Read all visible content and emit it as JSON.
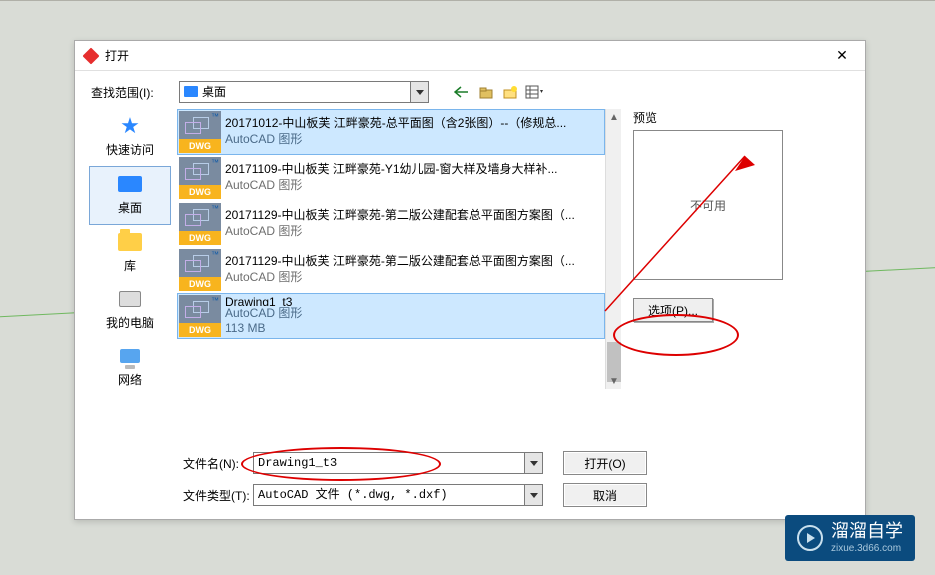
{
  "dialog": {
    "title": "打开",
    "find_label": "查找范围(I):",
    "directory": "桌面",
    "close_glyph": "✕"
  },
  "places": [
    {
      "label": "快速访问",
      "icon": "star"
    },
    {
      "label": "桌面",
      "icon": "monitor",
      "selected": true
    },
    {
      "label": "库",
      "icon": "folder"
    },
    {
      "label": "我的电脑",
      "icon": "pc"
    },
    {
      "label": "网络",
      "icon": "net"
    }
  ],
  "files": [
    {
      "title": "20171012-中山板芙 江畔豪苑-总平面图（含2张图）--（修规总...",
      "type": "AutoCAD 图形",
      "meta": "",
      "selected": true
    },
    {
      "title": "20171109-中山板芙 江畔豪苑-Y1幼儿园-窗大样及墙身大样补...",
      "type": "AutoCAD 图形",
      "meta": ""
    },
    {
      "title": "20171129-中山板芙 江畔豪苑-第二版公建配套总平面图方案图（...",
      "type": "AutoCAD 图形",
      "meta": ""
    },
    {
      "title": "20171129-中山板芙 江畔豪苑-第二版公建配套总平面图方案图（...",
      "type": "AutoCAD 图形",
      "meta": ""
    },
    {
      "title": "Drawing1_t3",
      "type": "AutoCAD 图形",
      "meta": "113 MB",
      "selected": true
    }
  ],
  "thumb": {
    "dwg": "DWG",
    "tm": "™"
  },
  "fields": {
    "name_label": "文件名(N):",
    "name_value": "Drawing1_t3",
    "type_label": "文件类型(T):",
    "type_value": "AutoCAD 文件 (*.dwg, *.dxf)"
  },
  "buttons": {
    "open": "打开(O)",
    "cancel": "取消",
    "options": "选项(P)..."
  },
  "preview": {
    "label": "预览",
    "unavailable": "不可用"
  },
  "watermark": {
    "main": "溜溜自学",
    "sub": "zixue.3d66.com"
  }
}
